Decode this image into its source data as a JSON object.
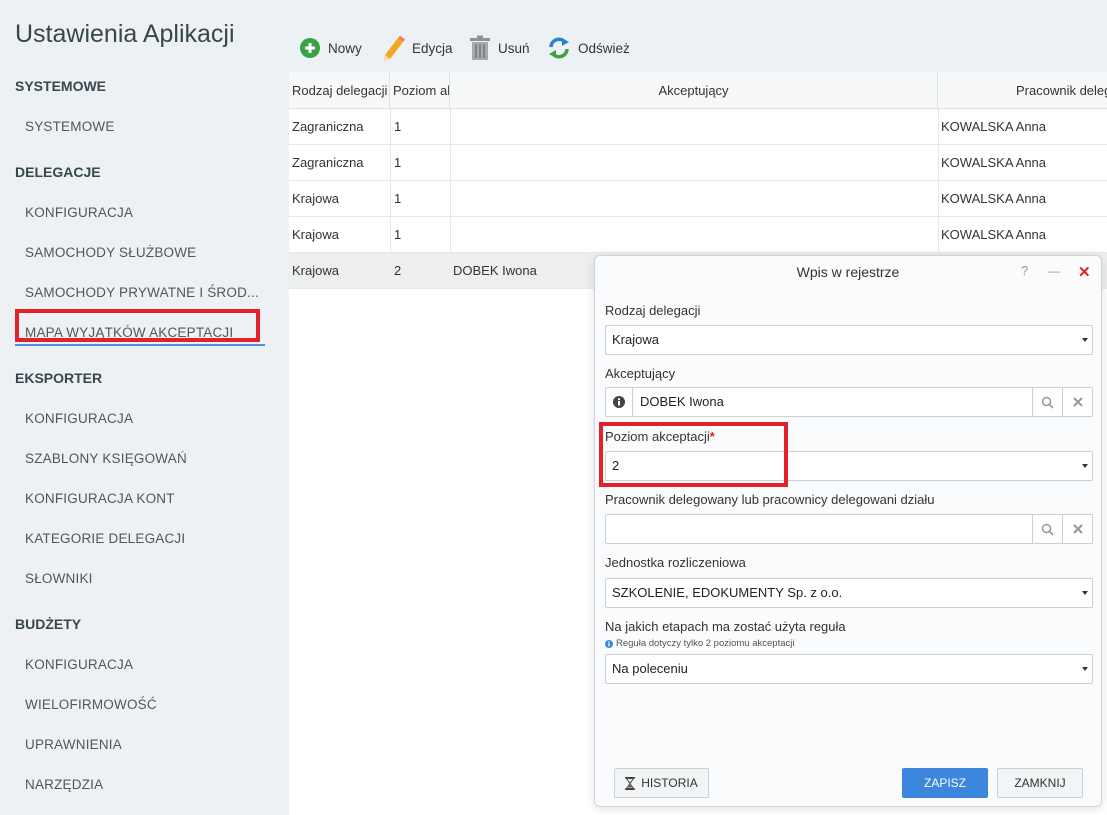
{
  "sidebar": {
    "title": "Ustawienia Aplikacji",
    "sections": [
      {
        "header": "SYSTEMOWE",
        "items": [
          "SYSTEMOWE"
        ]
      },
      {
        "header": "DELEGACJE",
        "items": [
          "KONFIGURACJA",
          "SAMOCHODY SŁUŻBOWE",
          "SAMOCHODY PRYWATNE I ŚROD...",
          "MAPA WYJĄTKÓW AKCEPTACJI"
        ]
      },
      {
        "header": "EKSPORTER",
        "items": [
          "KONFIGURACJA",
          "SZABLONY KSIĘGOWAŃ",
          "KONFIGURACJA KONT",
          "KATEGORIE DELEGACJI",
          "SŁOWNIKI"
        ]
      },
      {
        "header": "BUDŻETY",
        "items": [
          "KONFIGURACJA",
          "WIELOFIRMOWOŚĆ",
          "UPRAWNIENIA",
          "NARZĘDZIA"
        ]
      }
    ],
    "active_item": "MAPA WYJĄTKÓW AKCEPTACJI"
  },
  "toolbar": {
    "new_label": "Nowy",
    "edit_label": "Edycja",
    "delete_label": "Usuń",
    "refresh_label": "Odśwież"
  },
  "grid": {
    "columns": [
      "Rodzaj delegacji",
      "Poziom akceptacji",
      "Akceptujący",
      "Pracownik delegowany"
    ],
    "rows": [
      [
        "Zagraniczna",
        "1",
        "",
        "KOWALSKA Anna"
      ],
      [
        "Zagraniczna",
        "1",
        "",
        "KOWALSKA Anna"
      ],
      [
        "Krajowa",
        "1",
        "",
        "KOWALSKA Anna"
      ],
      [
        "Krajowa",
        "1",
        "",
        "KOWALSKA Anna"
      ],
      [
        "Krajowa",
        "2",
        "DOBEK Iwona",
        ""
      ]
    ]
  },
  "modal": {
    "title": "Wpis w rejestrze",
    "help": "?",
    "minimize": "—",
    "close": "✕",
    "fields": {
      "rodzaj_label": "Rodzaj delegacji",
      "rodzaj_value": "Krajowa",
      "akceptujacy_label": "Akceptujący",
      "akceptujacy_value": "DOBEK Iwona",
      "poziom_label": "Poziom akceptacji",
      "poziom_required": "*",
      "poziom_value": "2",
      "pracownik_label": "Pracownik delegowany lub pracownicy delegowani działu",
      "pracownik_value": "",
      "jednostka_label": "Jednostka rozliczeniowa",
      "jednostka_value": "SZKOLENIE, EDOKUMENTY Sp. z o.o.",
      "etapy_label": "Na jakich etapach ma zostać użyta reguła",
      "etapy_hint": "Reguła dotyczy tylko 2 poziomu akceptacji",
      "etapy_value": "Na poleceniu"
    },
    "buttons": {
      "history": "HISTORIA",
      "save": "ZAPISZ",
      "close": "ZAMKNIJ"
    }
  },
  "colors": {
    "highlight_red": "#e3212b",
    "primary_blue": "#3c87dd",
    "add_green": "#3aa245"
  }
}
